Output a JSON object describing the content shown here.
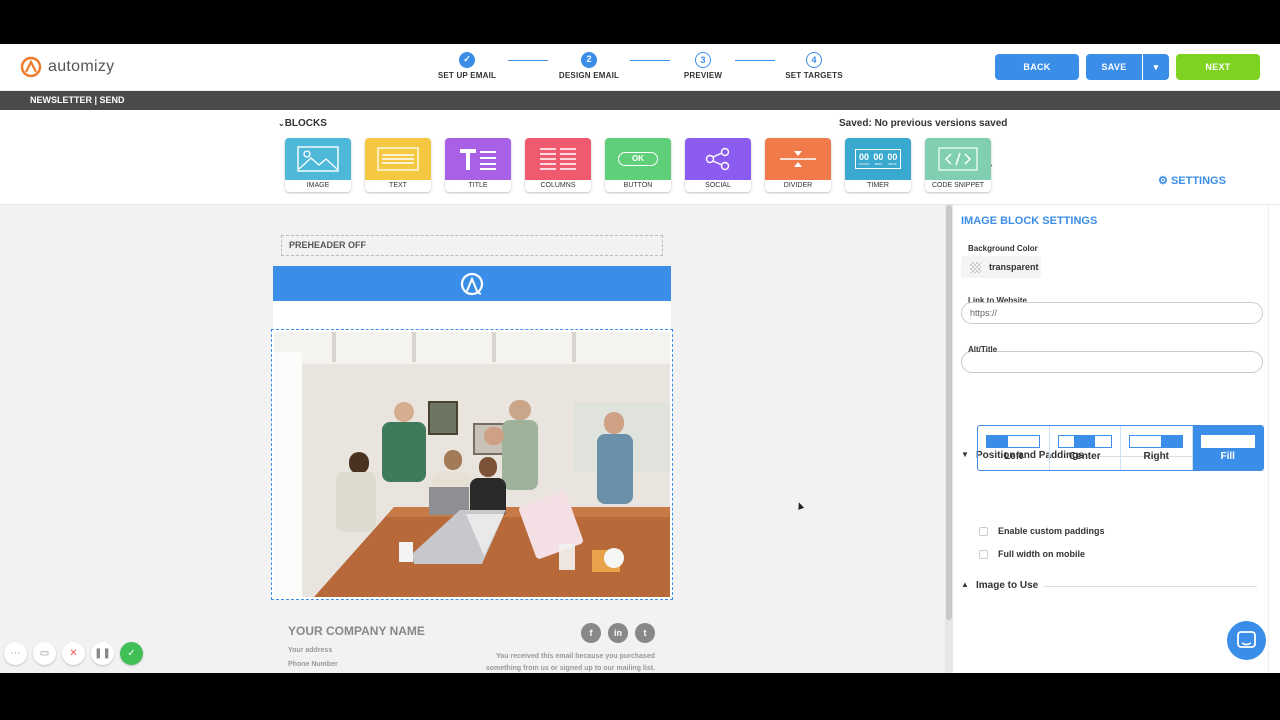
{
  "app": {
    "logo_text": "automizy"
  },
  "steps": [
    {
      "num": "",
      "label": "SET UP EMAIL",
      "state": "done"
    },
    {
      "num": "2",
      "label": "DESIGN EMAIL",
      "state": "current"
    },
    {
      "num": "3",
      "label": "PREVIEW",
      "state": "todo"
    },
    {
      "num": "4",
      "label": "SET TARGETS",
      "state": "todo"
    }
  ],
  "header_buttons": {
    "back": "BACK",
    "save": "SAVE",
    "next": "NEXT"
  },
  "breadcrumb": "NEWSLETTER | SEND",
  "blocks": {
    "title": "BLOCKS",
    "saved_status": "Saved: No previous versions saved",
    "items": [
      {
        "label": "IMAGE",
        "color": "#4db8d8",
        "icon": "image-icon"
      },
      {
        "label": "TEXT",
        "color": "#f5c842",
        "icon": "text-icon"
      },
      {
        "label": "TITLE",
        "color": "#a860e6",
        "icon": "title-icon"
      },
      {
        "label": "COLUMNS",
        "color": "#ef5a6f",
        "icon": "columns-icon"
      },
      {
        "label": "BUTTON",
        "color": "#5fcf7a",
        "icon": "button-icon",
        "inner": "OK"
      },
      {
        "label": "SOCIAL",
        "color": "#8c5cf0",
        "icon": "share-icon"
      },
      {
        "label": "DIVIDER",
        "color": "#f07a4a",
        "icon": "divider-icon"
      },
      {
        "label": "TIMER",
        "color": "#3aa9d0",
        "icon": "timer-icon",
        "digits": [
          "00",
          "00",
          "00"
        ],
        "units": [
          "HOURS",
          "MINS",
          "SECS"
        ]
      },
      {
        "label": "CODE SNIPPET",
        "color": "#7fcfb0",
        "icon": "code-icon"
      }
    ],
    "settings_link": "SETTINGS"
  },
  "email": {
    "preheader": "PREHEADER OFF",
    "company_name": "YOUR COMPANY NAME",
    "address": "Your address",
    "phone": "Phone Number",
    "notice_line1": "You received this email because you purchased",
    "notice_line2": "something from us or signed up to our mailing list.",
    "social": [
      "f",
      "in",
      "t"
    ]
  },
  "panel": {
    "title": "IMAGE BLOCK SETTINGS",
    "background_color_label": "Background Color",
    "background_color_value": "transparent",
    "link_label": "Link to Website",
    "link_placeholder": "https://",
    "alt_label": "Alt/Title",
    "alt_value": "",
    "position_section": "Position and Paddings",
    "positions": [
      "Left",
      "Center",
      "Right",
      "Fill"
    ],
    "active_position": "Fill",
    "custom_paddings_label": "Enable custom paddings",
    "full_width_label": "Full width on mobile",
    "image_section": "Image to Use"
  },
  "colors": {
    "accent": "#3b8ee8",
    "next": "#7ed321",
    "titlebar": "#4a4a4a"
  }
}
